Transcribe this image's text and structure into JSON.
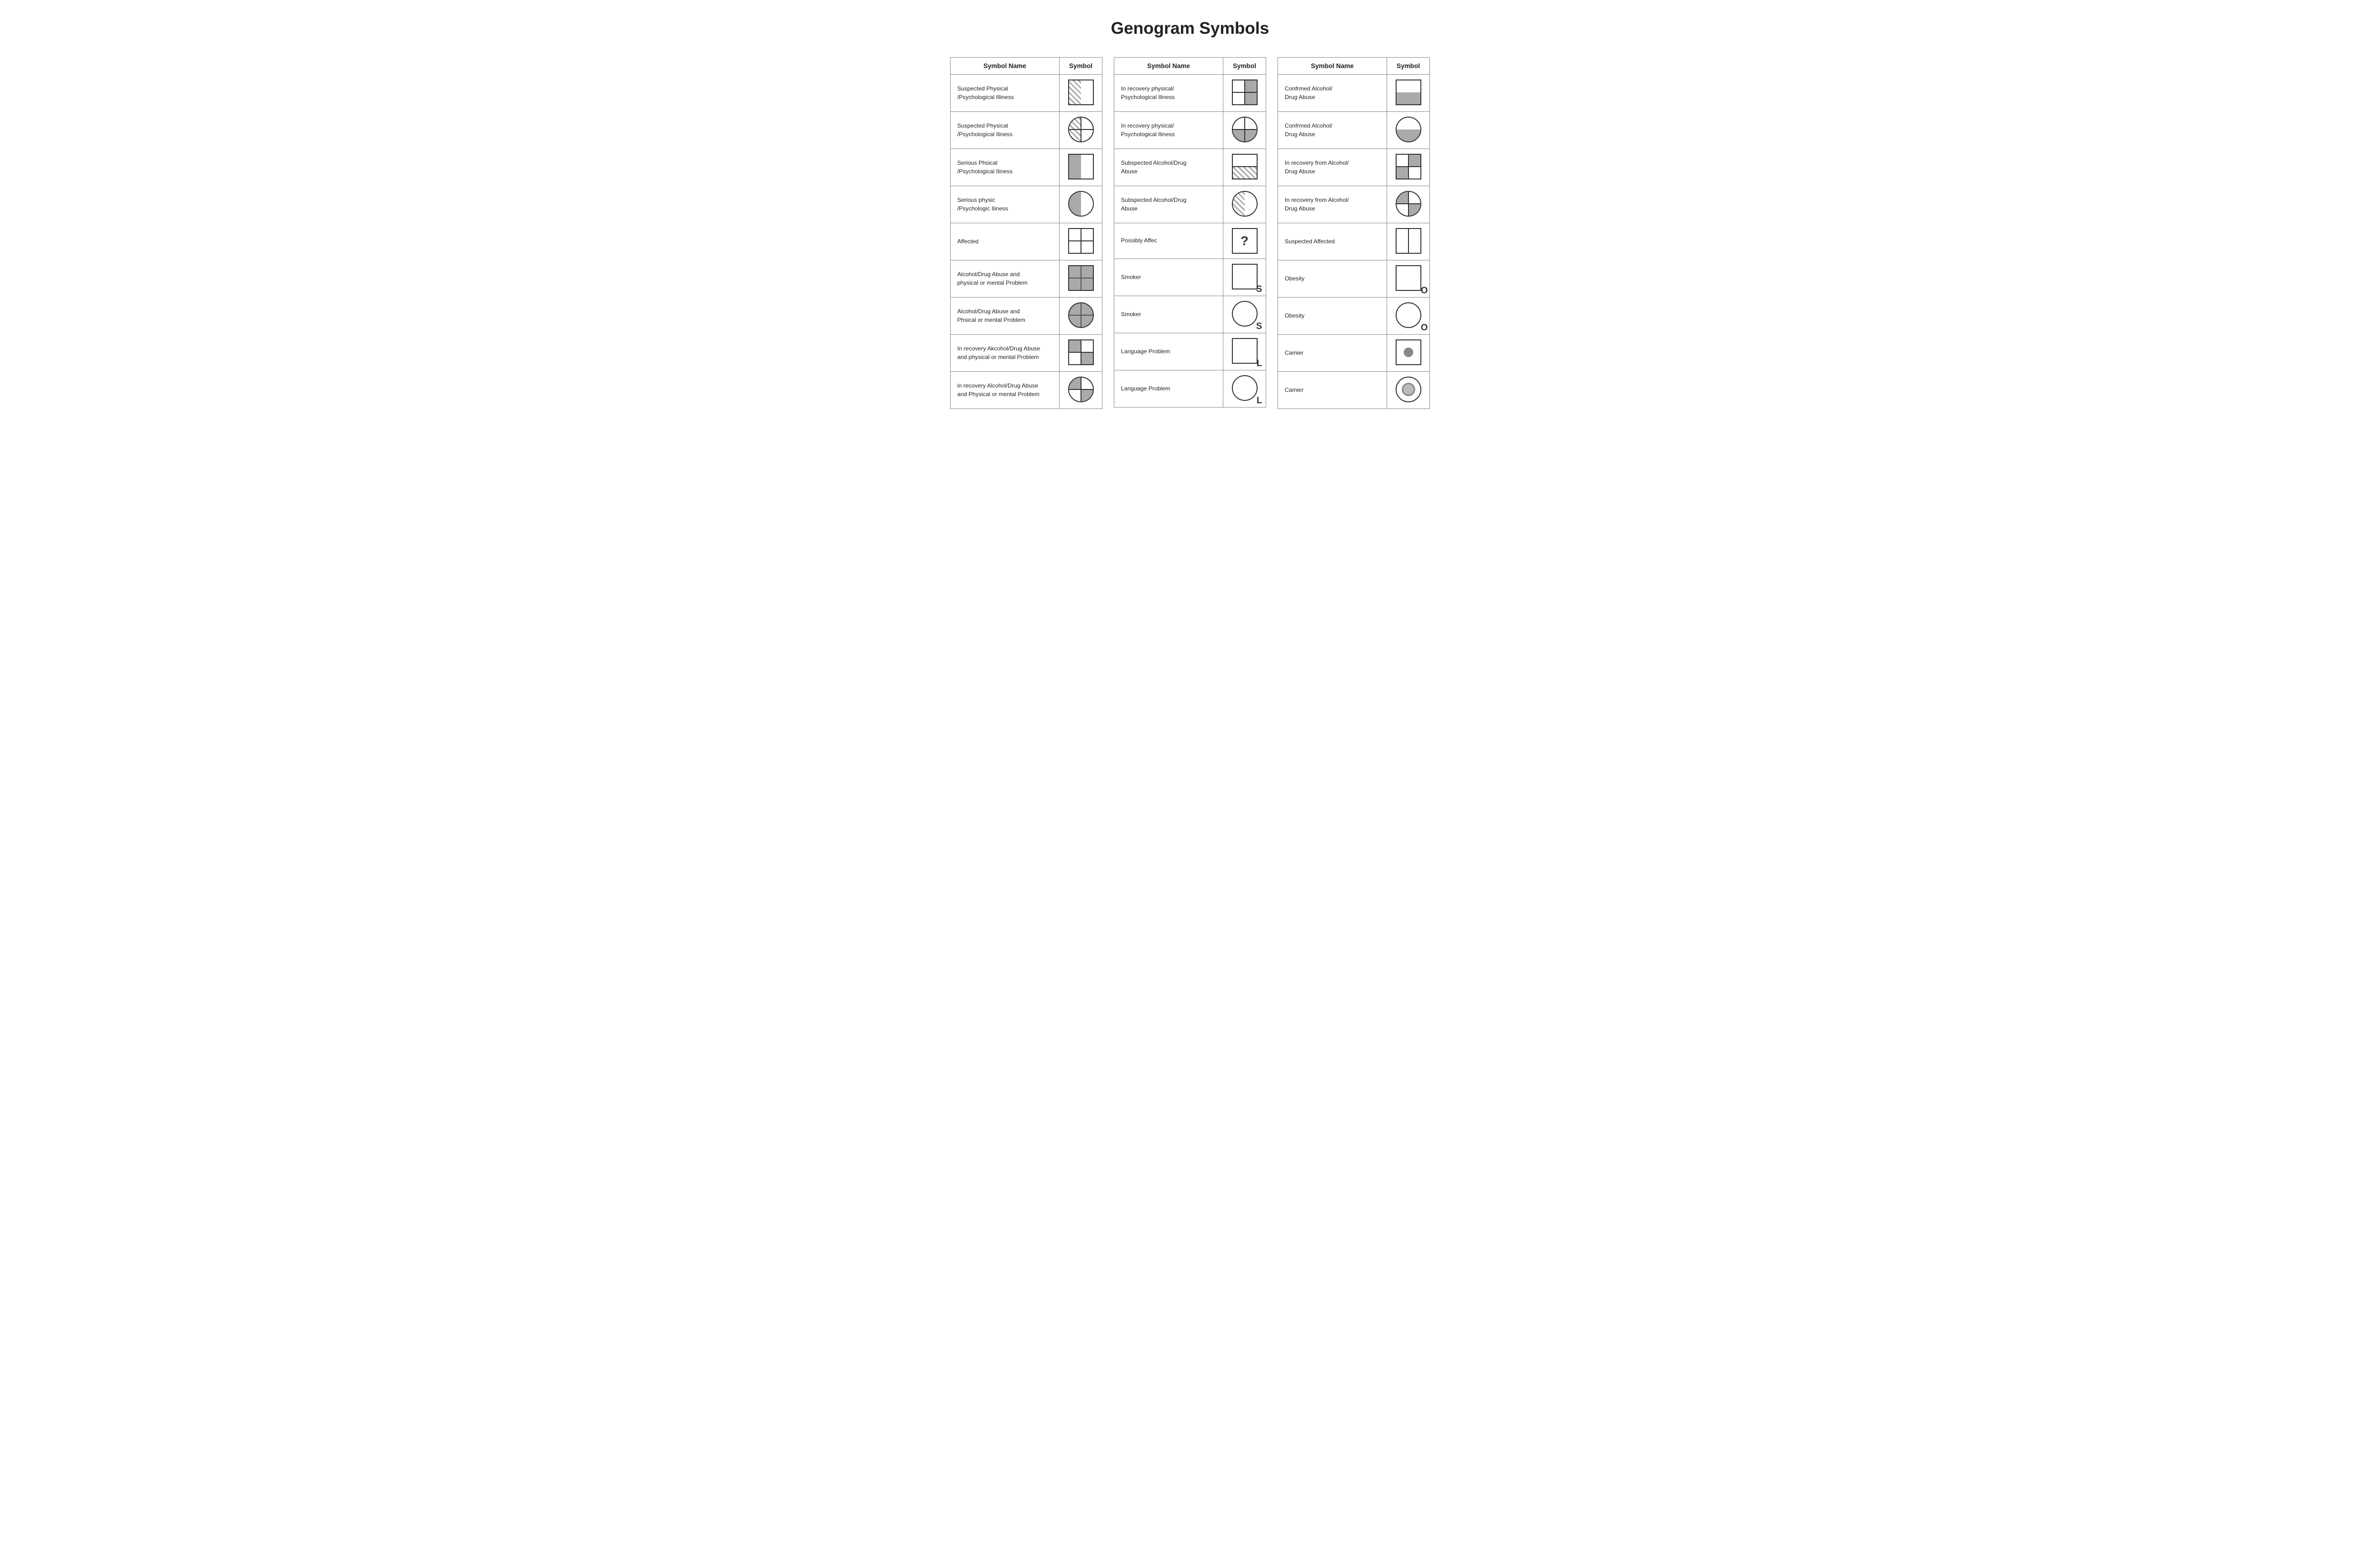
{
  "title": "Genogram Symbols",
  "tables": [
    {
      "id": "table1",
      "headers": [
        "Symbol Name",
        "Symbol"
      ],
      "rows": [
        {
          "name": "Suspected Physical\n/Psychological Illiness",
          "symbol_type": "sq_hatch_left"
        },
        {
          "name": "Suspected Physical\n/Psychological Iliness",
          "symbol_type": "ci_hatch_left"
        },
        {
          "name": "Serious Phsical\n/Psychological Iliness",
          "symbol_type": "sq_grey_left"
        },
        {
          "name": "Serious physic\n/Psychologic Iliness",
          "symbol_type": "ci_grey_left"
        },
        {
          "name": "Affected",
          "symbol_type": "sq_4cross"
        },
        {
          "name": "Alcohol/Drug Abuse and\nphysical or mental Problem",
          "symbol_type": "sq_all4_grey"
        },
        {
          "name": "Alcohol/Drug Abuse and\nPhsical or mental Problem",
          "symbol_type": "ci_all4_grey"
        },
        {
          "name": "In recovery Akcohol/Drug Abuse\nand physical or mental Problem",
          "symbol_type": "sq_tl_br_grey"
        },
        {
          "name": "in recovery Alcohol/Drug Abuse\nand Physical or mental Problem",
          "symbol_type": "ci_tl_br_grey"
        }
      ]
    },
    {
      "id": "table2",
      "headers": [
        "Symbol Name",
        "Symbol"
      ],
      "rows": [
        {
          "name": "In recovery physical/\nPsychological Iliness",
          "symbol_type": "sq_tr_br_grey"
        },
        {
          "name": "In recovery physical/\nPsychological Iliness",
          "symbol_type": "ci_bottom_grey"
        },
        {
          "name": "Subspected Alcohol/Drug\nAbuse",
          "symbol_type": "sq_hatch_bottom"
        },
        {
          "name": "Subspected Alcohol/Drug\nAbuse",
          "symbol_type": "ci_hatch_full_left"
        },
        {
          "name": "Possibly Affec",
          "symbol_type": "sq_question"
        },
        {
          "name": "Smoker",
          "symbol_type": "sq_S"
        },
        {
          "name": "Smoker",
          "symbol_type": "ci_S"
        },
        {
          "name": "Language Problem",
          "symbol_type": "sq_L"
        },
        {
          "name": "Language Problem",
          "symbol_type": "ci_L"
        }
      ]
    },
    {
      "id": "table3",
      "headers": [
        "Symbol Name",
        "Symbol"
      ],
      "rows": [
        {
          "name": "Confrmed Alcohol/\nDrug Abuse",
          "symbol_type": "sq_bottom_grey"
        },
        {
          "name": "Confrmed Alcohol/\nDrug Abuse",
          "symbol_type": "ci_bottom_grey2"
        },
        {
          "name": "In recovery from Alcohol/\nDrug Abuse",
          "symbol_type": "sq_tr_bl_grey"
        },
        {
          "name": "In recovery from Alcohol/\nDrug Abuse",
          "symbol_type": "ci_q_tl_br"
        },
        {
          "name": "Suspected Affected",
          "symbol_type": "sq_vert"
        },
        {
          "name": "Obesity",
          "symbol_type": "sq_O"
        },
        {
          "name": "Obesity",
          "symbol_type": "ci_O"
        },
        {
          "name": "Camier",
          "symbol_type": "sq_carrier"
        },
        {
          "name": "Camier",
          "symbol_type": "ci_carrier"
        }
      ]
    }
  ]
}
